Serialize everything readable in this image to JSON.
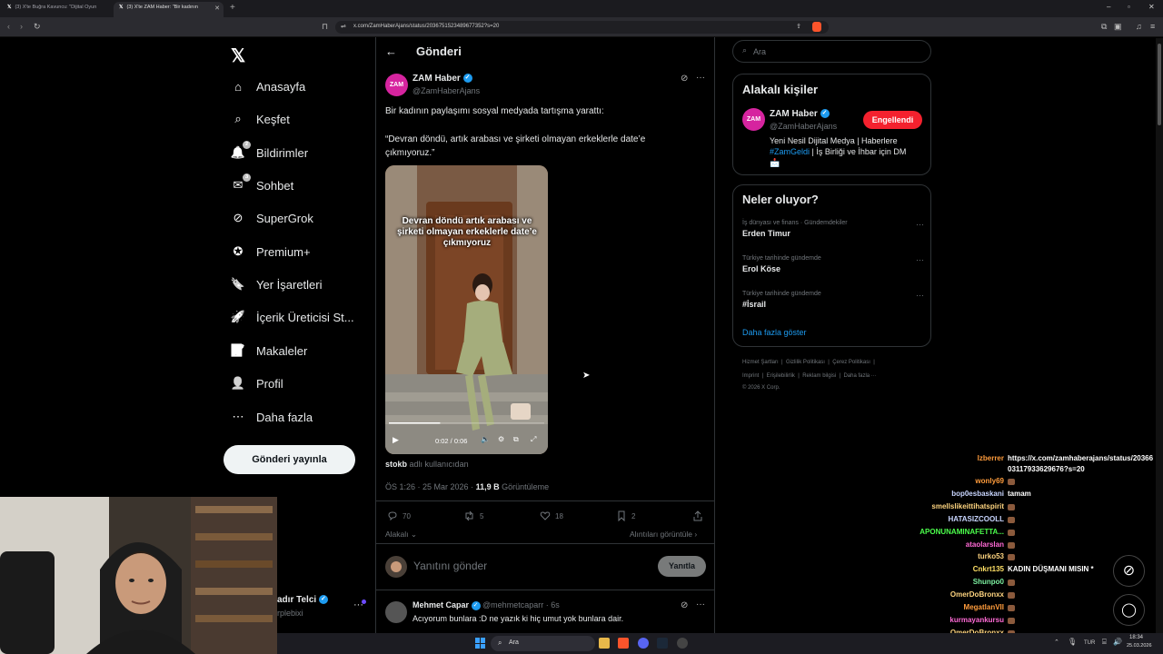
{
  "browser": {
    "tabs": [
      {
        "label": "(3) X'te Buğra Kavuncu: \"Dijital Oyun"
      },
      {
        "label": "(3) X'te ZAM Haber: \"Bir kadının"
      }
    ],
    "url": "x.com/ZamHaberAjans/status/2036751523489677352?s=20"
  },
  "sidebar": {
    "items": [
      {
        "label": "Anasayfa",
        "icon": "home-icon"
      },
      {
        "label": "Keşfet",
        "icon": "search-icon"
      },
      {
        "label": "Bildirimler",
        "icon": "bell-icon",
        "badge": "2"
      },
      {
        "label": "Sohbet",
        "icon": "mail-icon",
        "badge": "3"
      },
      {
        "label": "SuperGrok",
        "icon": "grok-icon"
      },
      {
        "label": "Premium+",
        "icon": "premium-icon"
      },
      {
        "label": "Yer İşaretleri",
        "icon": "bookmark-icon"
      },
      {
        "label": "İçerik Üreticisi St...",
        "icon": "rocket-icon"
      },
      {
        "label": "Makaleler",
        "icon": "article-icon"
      },
      {
        "label": "Profil",
        "icon": "profile-icon"
      },
      {
        "label": "Daha fazla",
        "icon": "more-circle-icon"
      }
    ],
    "post_button": "Gönderi yayınla",
    "account": {
      "name": "adır Telci",
      "handle": "rplebixi"
    }
  },
  "header": {
    "title": "Gönderi"
  },
  "post": {
    "author_name": "ZAM Haber",
    "author_handle": "@ZamHaberAjans",
    "avatar_text": "ZAM",
    "text_line1": "Bir kadının paylaşımı sosyal medyada tartışma yarattı:",
    "text_line2": "“Devran döndü, artık arabası ve şirketi olmayan erkeklerle date’e çıkmıyoruz.”",
    "video_caption": "Devran döndü artık arabası ve şirketi olmayan erkeklerle date’e çıkmıyoruz",
    "video_time": "0:02 / 0:06",
    "video_progress": 0.33,
    "source_user": "stokb",
    "source_suffix": "adlı kullanıcıdan",
    "timestamp": "ÖS 1:26 · 25 Mar 2026 ·",
    "views_count": "11,9 B",
    "views_label": "Görüntüleme",
    "replies": "70",
    "reposts": "5",
    "likes": "18",
    "bookmarks": "2",
    "relevance": "Alakalı",
    "quotes_link": "Alıntıları görüntüle"
  },
  "reply_box": {
    "placeholder": "Yanıtını gönder",
    "button": "Yanıtla"
  },
  "reply": {
    "name": "Mehmet Capar",
    "handle": "@mehmetcaparr · 6s",
    "text": "Acıyorum bunlara :D ne yazık ki hiç umut yok bunlara dair."
  },
  "right": {
    "search_placeholder": "Ara",
    "relevant_title": "Alakalı kişiler",
    "person_name": "ZAM Haber",
    "person_handle": "@ZamHaberAjans",
    "person_button": "Engellendi",
    "bio_line1": "Yeni Nesil Dijital Medya | Haberlere",
    "bio_hashtag": "#ZamGeldi",
    "bio_line2": " | İş Birliği ve İhbar için DM",
    "bio_emoji": "📩",
    "trending_title": "Neler oluyor?",
    "trends": [
      {
        "context": "İş dünyası ve finans · Gündemdekiler",
        "title": "Erden Timur"
      },
      {
        "context": "Türkiye tarihinde gündemde",
        "title": "Erol Köse"
      },
      {
        "context": "Türkiye tarihinde gündemde",
        "title": "#İsrail"
      }
    ],
    "show_more": "Daha fazla göster",
    "footer_line1": [
      "Hizmet Şartları",
      "|",
      "Gizlilik Politikası",
      "|",
      "Çerez Politikası",
      "|"
    ],
    "footer_line2": [
      "Imprint",
      "|",
      "Erişilebilirlik",
      "|",
      "Reklam bilgisi",
      "|",
      "Daha fazla ···"
    ],
    "footer_line3": "© 2026 X Corp."
  },
  "chat": {
    "top_line1": "https://x.com/zamhaberajans/status/20366",
    "top_line2": "03117933629676?s=20",
    "top_user": "lzberrer",
    "messages": [
      {
        "user": "wonly69",
        "msg": "",
        "color": "#ff9c3c",
        "emote": true
      },
      {
        "user": "bop0esbaskani",
        "msg": "tamam",
        "color": "#c9d6ff"
      },
      {
        "user": "smellslikeittihatspirit",
        "msg": "",
        "color": "#ffd580",
        "emote": true
      },
      {
        "user": "HATASIZCOOLL",
        "msg": "",
        "color": "#c9d6ff",
        "emote": true
      },
      {
        "user": "APONUNAMINAFETTA...",
        "msg": "",
        "color": "#4cff4c",
        "emote": true
      },
      {
        "user": "ataolarslan",
        "msg": "",
        "color": "#ff6ad5",
        "emote": true
      },
      {
        "user": "turko53",
        "msg": "",
        "color": "#ffd580",
        "emote": true
      },
      {
        "user": "Cnkrt135",
        "msg": "KADIN DÜŞMANI MISIN *",
        "color": "#ffe066"
      },
      {
        "user": "Shunpo0",
        "msg": "",
        "color": "#7cf0a0",
        "emote": true
      },
      {
        "user": "OmerDoBronxx",
        "msg": "",
        "color": "#ffd580",
        "emote": true
      },
      {
        "user": "MegatlanVII",
        "msg": "",
        "color": "#ff9c3c",
        "emote": true
      },
      {
        "user": "kurmayankursu",
        "msg": "",
        "color": "#ff6ad5",
        "emote": true
      },
      {
        "user": "OmerDoBronxx",
        "msg": "",
        "color": "#ffd580",
        "emote": true
      },
      {
        "user": "Gravitas0",
        "msg": "",
        "color": "#ff6ad5",
        "emote": true
      }
    ]
  },
  "taskbar": {
    "search": "Ara",
    "lang": "TUR",
    "time": "18:34",
    "date": "25.03.2026"
  }
}
